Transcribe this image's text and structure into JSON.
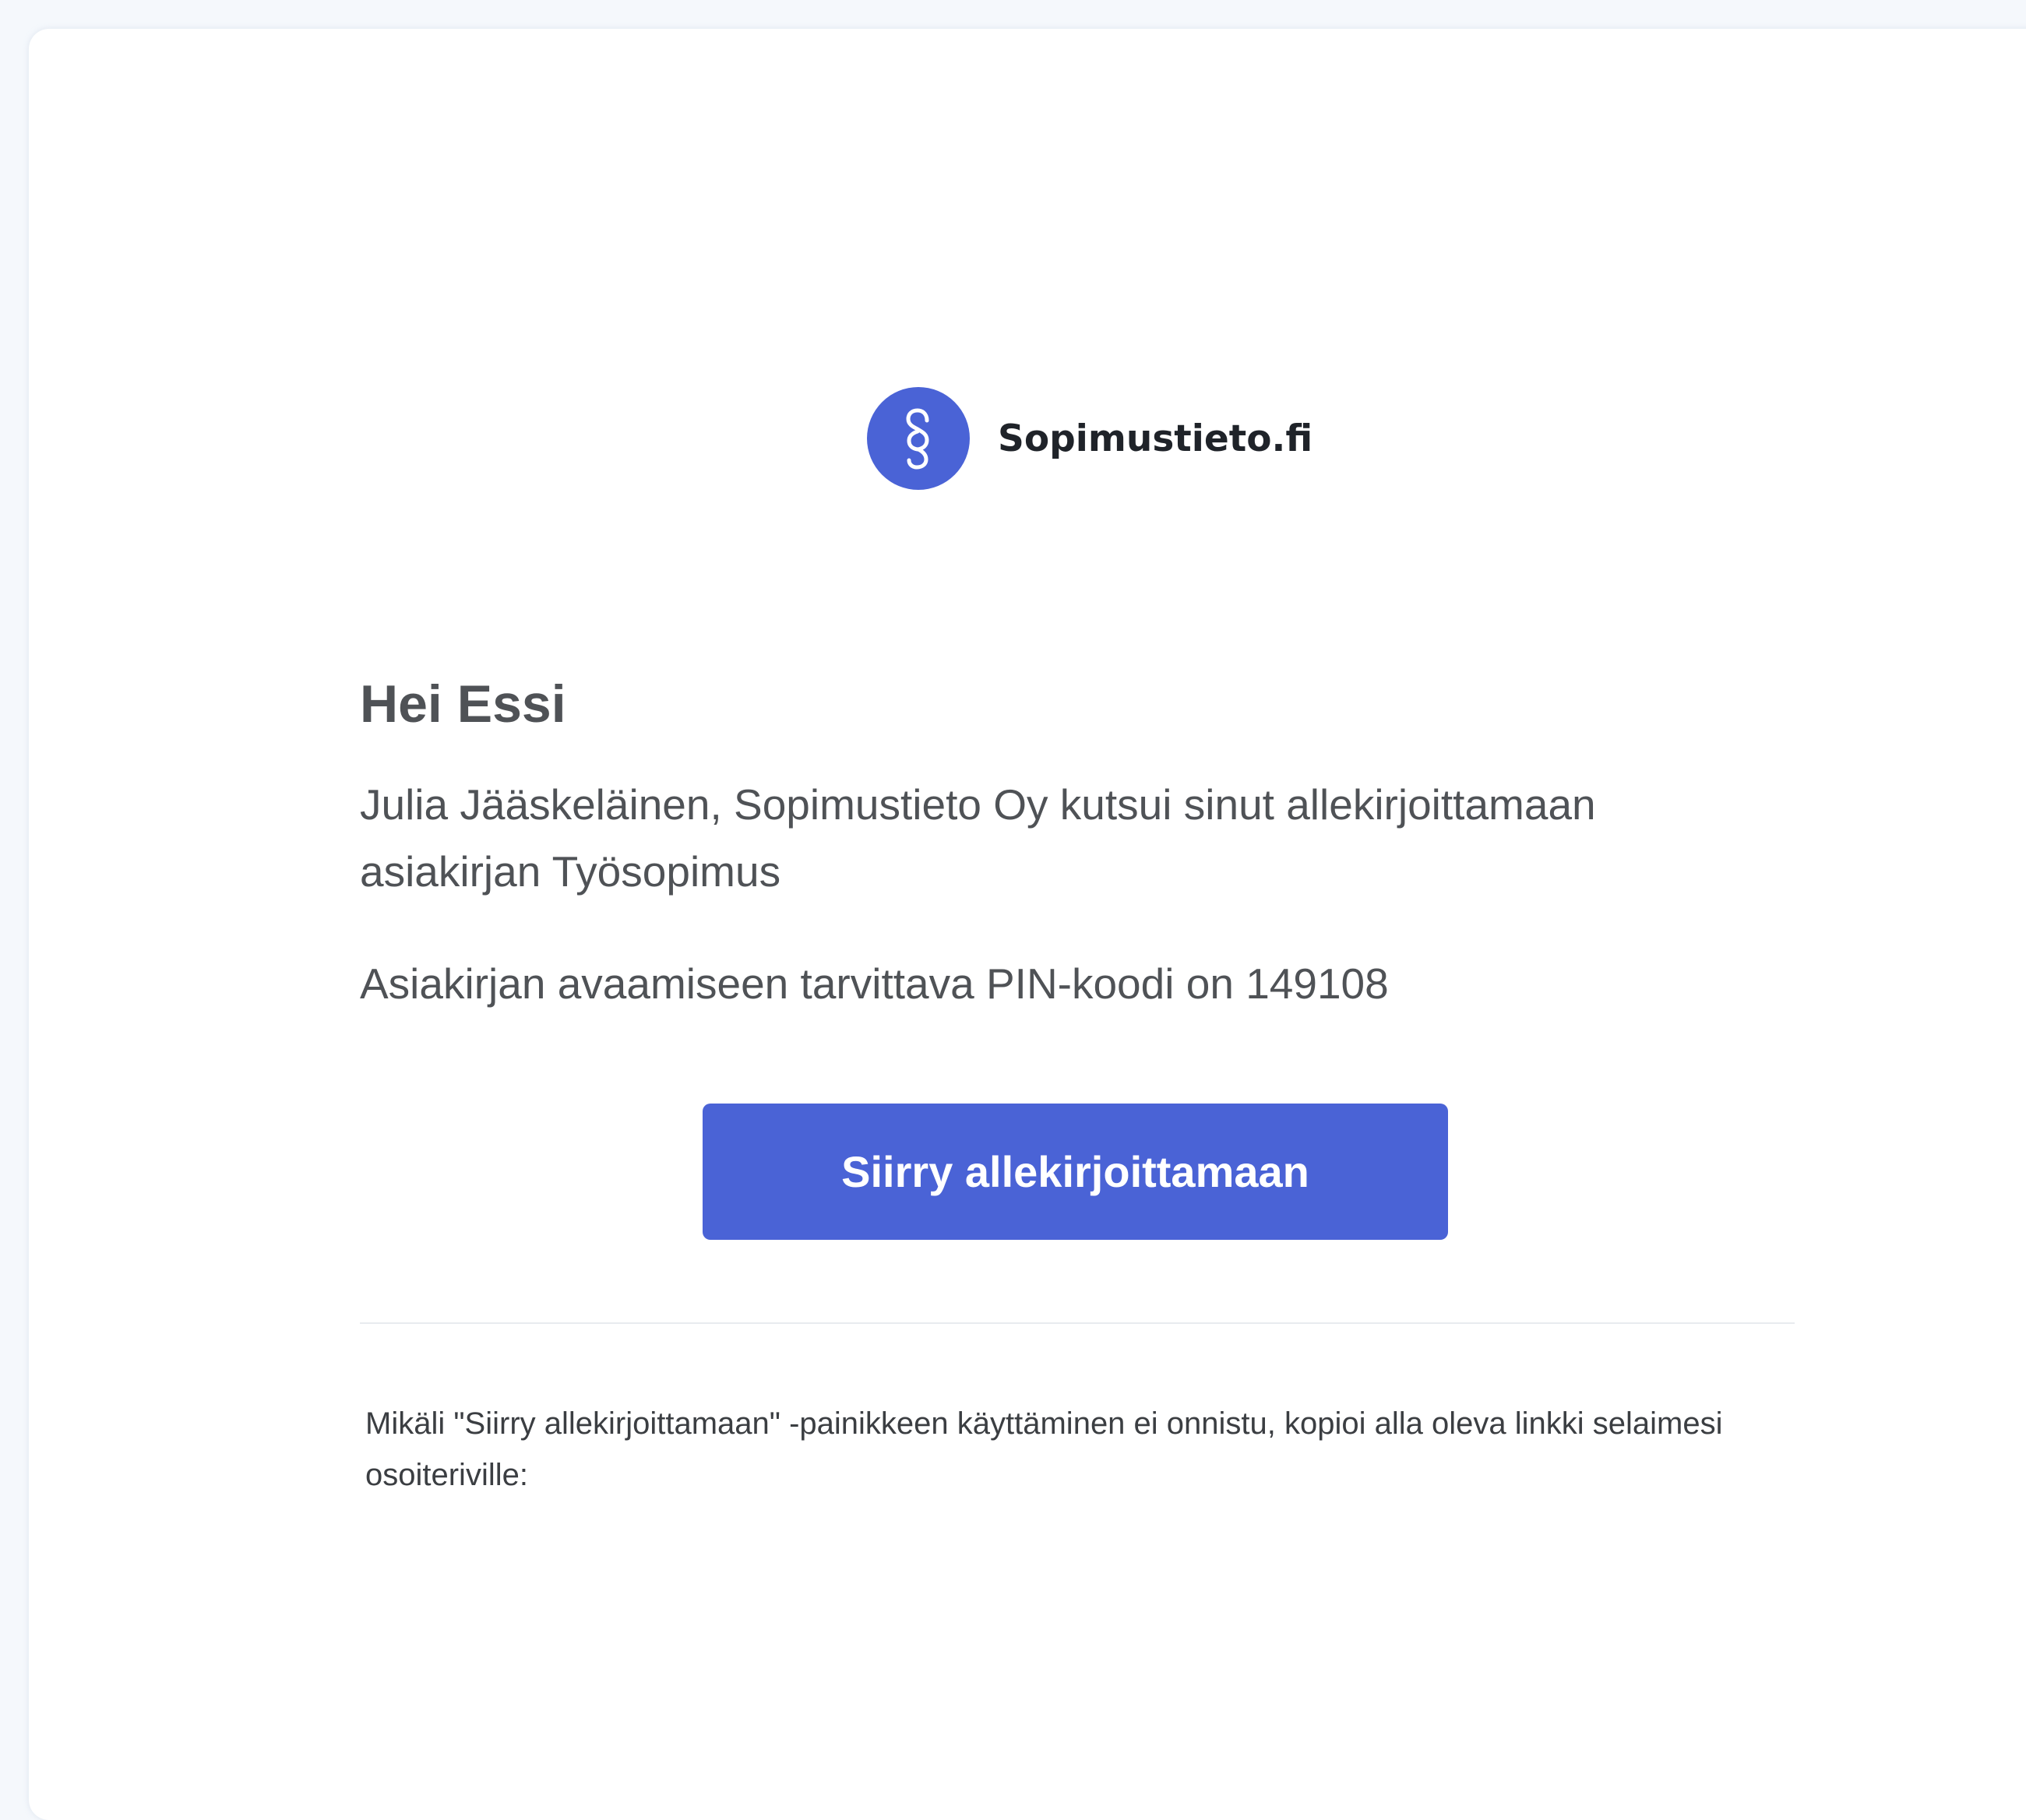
{
  "colors": {
    "brand_blue": "#4a63d6",
    "text_dark": "#4f5256",
    "text_small": "#3b3e42",
    "page_background": "#f5f8fc"
  },
  "header": {
    "logo_icon": "section-sign-icon",
    "brand_name": "Sopimustieto.fi"
  },
  "message": {
    "greeting": "Hei Essi",
    "invitation": "Julia Jääskeläinen, Sopimustieto Oy kutsui sinut allekirjoittamaan asiakirjan Työsopimus",
    "pin_notice": "Asiakirjan avaamiseen tarvittava PIN-koodi on 149108",
    "cta_label": "Siirry allekirjoittamaan"
  },
  "footer": {
    "fallback_text": "Mikäli \"Siirry allekirjoittamaan\" -painikkeen käyttäminen ei onnistu, kopioi alla oleva linkki selaimesi osoiteriville:"
  }
}
